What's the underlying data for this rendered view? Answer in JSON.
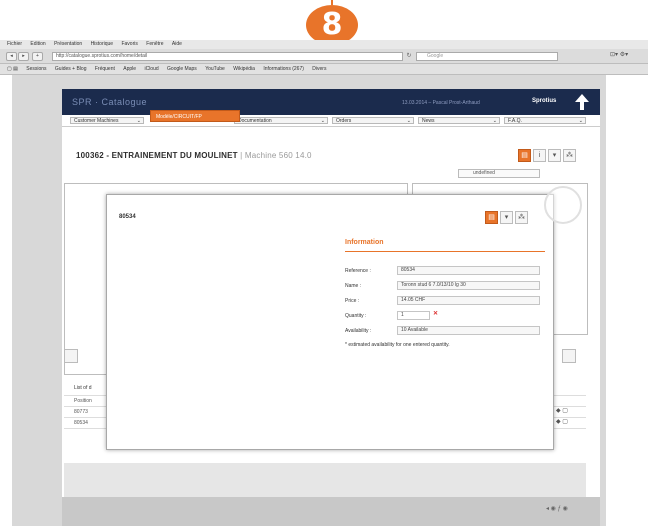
{
  "step": {
    "number": "8",
    "color": "#e8742a"
  },
  "browser": {
    "menu": [
      "Fichier",
      "Edition",
      "Présentation",
      "Historique",
      "Favoris",
      "Fenêtre",
      "Aide"
    ],
    "url": "http://catalogue.sprotius.com/home/detail",
    "search_placeholder": "Google",
    "bookmarks": [
      "Sessions",
      "Guides + Blog",
      "Fréquent",
      "Apple",
      "iCloud",
      "Google Maps",
      "YouTube",
      "Wikipédia",
      "Informations (267)",
      "Divers"
    ]
  },
  "app": {
    "title": "SPR · Catalogue",
    "user_info": "13.03.2014 – Pascal Prost-Arthaud",
    "logo_text": "Sprotius",
    "nav": {
      "customer_machines": "Customer Machines",
      "spare_parts": "Modèle/CIRCUIT/FP",
      "documentation": "Documentation",
      "orders": "Orders",
      "news": "News",
      "faq": "F.A.Q."
    }
  },
  "page": {
    "title": "100362 - ENTRAINEMENT DU MOULINET",
    "subtitle": "| Machine 560 14.0",
    "language": "undefined",
    "table_header": "List of d",
    "rows": [
      "Position",
      "80773",
      "80534"
    ]
  },
  "modal": {
    "title": "80534",
    "section_title": "Information",
    "fields": {
      "reference_label": "Reference :",
      "reference_value": "80534",
      "name_label": "Name :",
      "name_value": "Toronn stud 6 7.0/13/10 lg 30",
      "price_label": "Price :",
      "price_value": "14.05 CHF",
      "quantity_label": "Quantity :",
      "quantity_value": "1",
      "availability_label": "Availability :",
      "availability_value": "10 Available"
    },
    "note": "* estimated availability for one entered quantity."
  }
}
